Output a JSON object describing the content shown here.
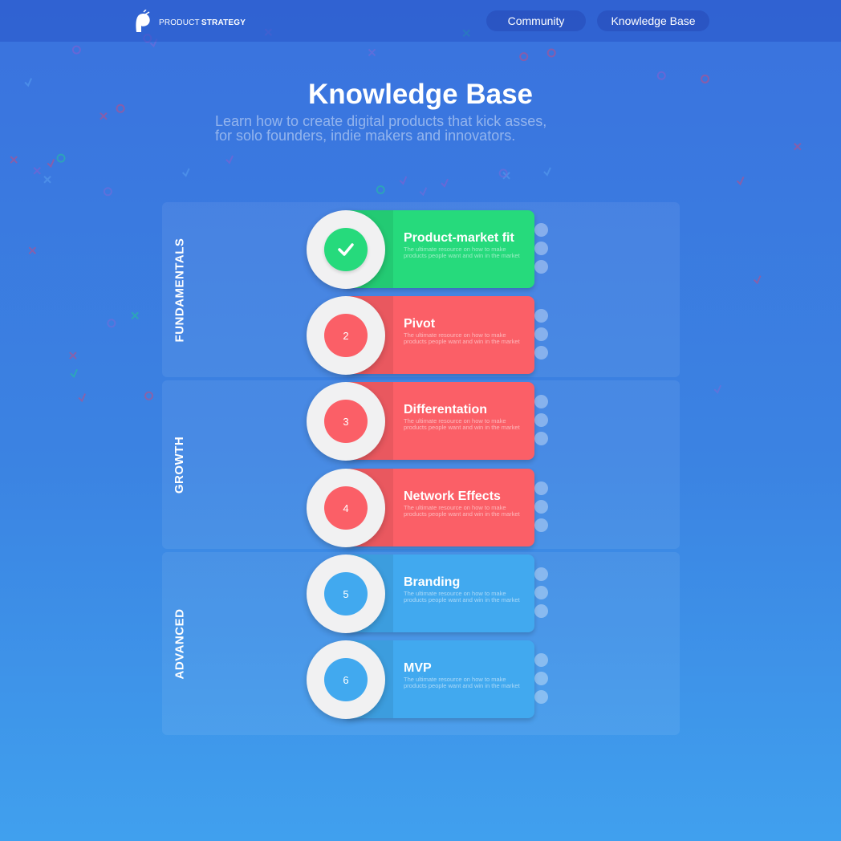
{
  "nav": {
    "logo_text_light": "PRODUCT",
    "logo_text_bold": "STRATEGY",
    "links": [
      "Community",
      "Knowledge Base"
    ]
  },
  "hero": {
    "title": "Knowledge Base",
    "subtitle_line1": "Learn how to create digital products that kick asses,",
    "subtitle_line2": "for solo founders, indie makers and innovators."
  },
  "sections": [
    {
      "label": "FUNDAMENTALS"
    },
    {
      "label": "GROWTH"
    },
    {
      "label": "ADVANCED"
    }
  ],
  "topics": [
    {
      "badge": "check-icon",
      "title": "Product-market fit",
      "description": "The ultimate resource on how to make products people want and win in the market",
      "status": "completed",
      "color": "#26da7c"
    },
    {
      "badge": "2",
      "title": "Pivot",
      "description": "The ultimate resource on how to make products people want and win in the market",
      "status": "locked",
      "color": "#fb5f67"
    },
    {
      "badge": "3",
      "title": "Differentation",
      "description": "The ultimate resource on how to make products people want and win in the market",
      "status": "locked",
      "color": "#fb5f67"
    },
    {
      "badge": "4",
      "title": "Network Effects",
      "description": "The ultimate resource on how to make products people want and win in the market",
      "status": "locked",
      "color": "#fb5f67"
    },
    {
      "badge": "5",
      "title": "Branding",
      "description": "The ultimate resource on how to make products people want and win in the market",
      "status": "available",
      "color": "#41a9ef"
    },
    {
      "badge": "6",
      "title": "MVP",
      "description": "The ultimate resource on how to make products people want and win in the market",
      "status": "available",
      "color": "#41a9ef"
    }
  ],
  "colors": {
    "background_top": "#3a72de",
    "background_bottom": "#40a0ee",
    "green": "#26da7c",
    "red": "#fb5f67",
    "blue": "#41a9ef"
  }
}
